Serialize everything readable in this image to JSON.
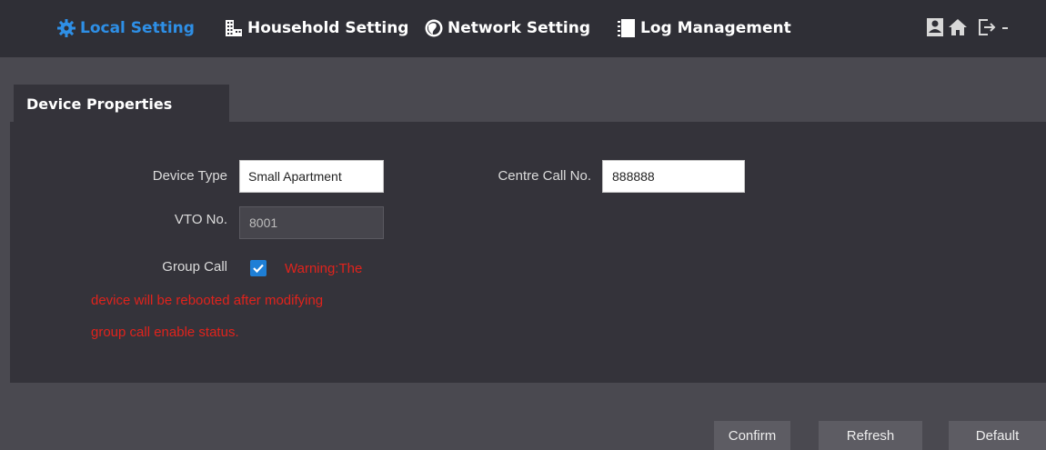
{
  "nav": {
    "items": [
      {
        "label": "Local Setting",
        "icon": "gear-icon",
        "active": true
      },
      {
        "label": "Household Setting",
        "icon": "building-icon",
        "active": false
      },
      {
        "label": "Network Setting",
        "icon": "globe-icon",
        "active": false
      },
      {
        "label": "Log Management",
        "icon": "log-icon",
        "active": false
      }
    ],
    "right_icons": [
      "user-icon",
      "home-icon",
      "logout-icon",
      "dropdown-caret-icon"
    ]
  },
  "tab": {
    "label": "Device Properties"
  },
  "form": {
    "device_type": {
      "label": "Device Type",
      "value": "Small Apartment"
    },
    "centre_call": {
      "label": "Centre Call No.",
      "value": "888888"
    },
    "vto_no": {
      "label": "VTO No.",
      "value": "8001"
    },
    "group_call": {
      "label": "Group Call",
      "checked": true
    },
    "warning": {
      "line1": "Warning:The",
      "line2": "device will be rebooted after modifying",
      "line3": "group call enable status."
    }
  },
  "buttons": {
    "confirm": "Confirm",
    "refresh": "Refresh",
    "default": "Default"
  },
  "colors": {
    "accent": "#2e8fe6",
    "topbar": "#2f2f36",
    "panel": "#34333a",
    "background": "#4a4950",
    "warning": "#e0231c",
    "button": "#5d5c63"
  }
}
